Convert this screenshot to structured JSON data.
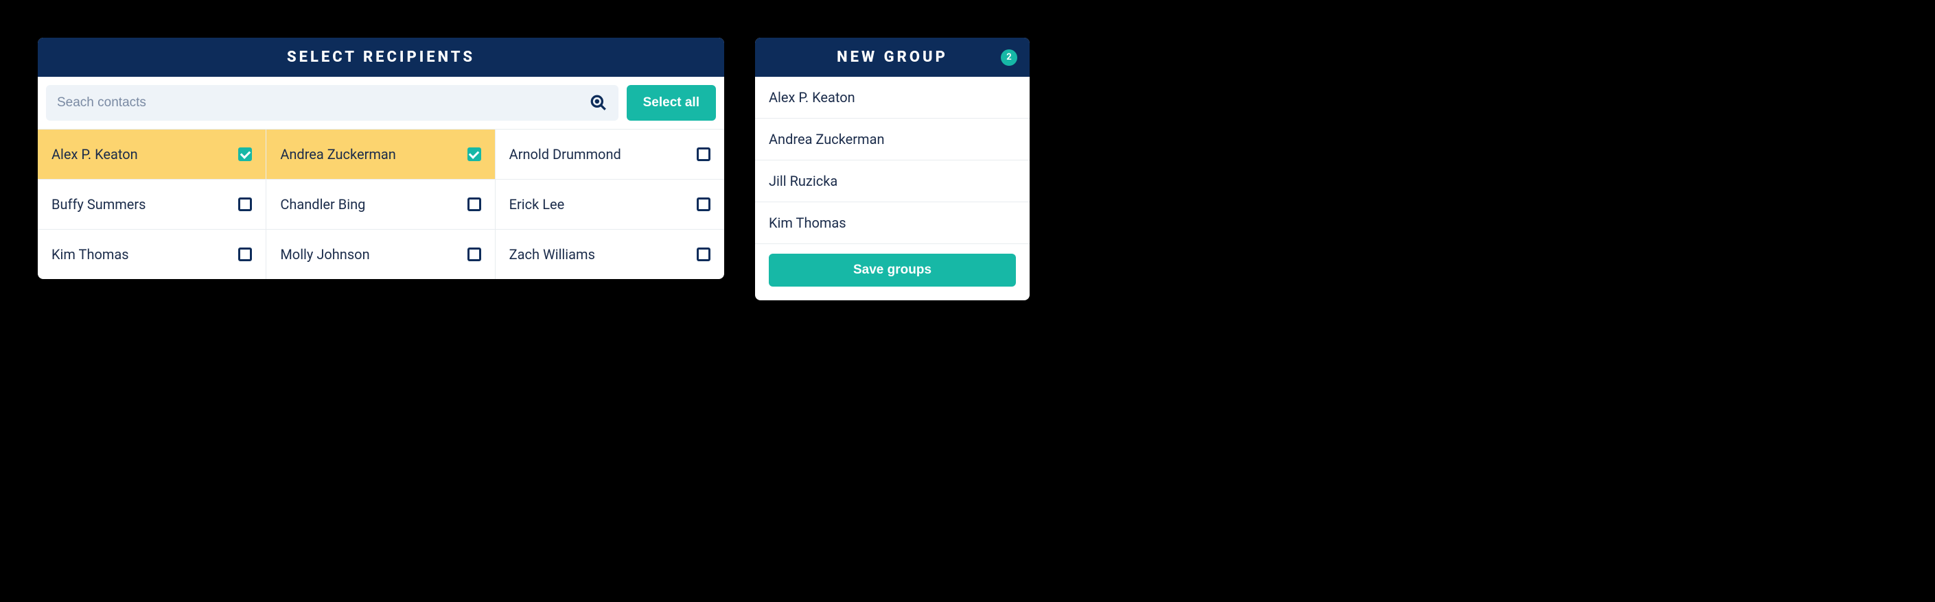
{
  "recipients": {
    "title": "SELECT RECIPIENTS",
    "search": {
      "placeholder": "Seach contacts"
    },
    "select_all_label": "Select all",
    "contacts": [
      {
        "name": "Alex P. Keaton",
        "selected": true
      },
      {
        "name": "Andrea Zuckerman",
        "selected": true
      },
      {
        "name": "Arnold Drummond",
        "selected": false
      },
      {
        "name": "Buffy Summers",
        "selected": false
      },
      {
        "name": "Chandler Bing",
        "selected": false
      },
      {
        "name": "Erick Lee",
        "selected": false
      },
      {
        "name": "Kim Thomas",
        "selected": false
      },
      {
        "name": "Molly Johnson",
        "selected": false
      },
      {
        "name": "Zach Williams",
        "selected": false
      }
    ]
  },
  "group": {
    "title": "NEW GROUP",
    "badge": "2",
    "members": [
      "Alex P. Keaton",
      "Andrea Zuckerman",
      "Jill Ruzicka",
      "Kim Thomas"
    ],
    "save_label": "Save groups"
  },
  "colors": {
    "header_bg": "#0d2c5a",
    "accent": "#17b8a6",
    "selected_bg": "#fcd46f",
    "text": "#1a2b4a"
  }
}
